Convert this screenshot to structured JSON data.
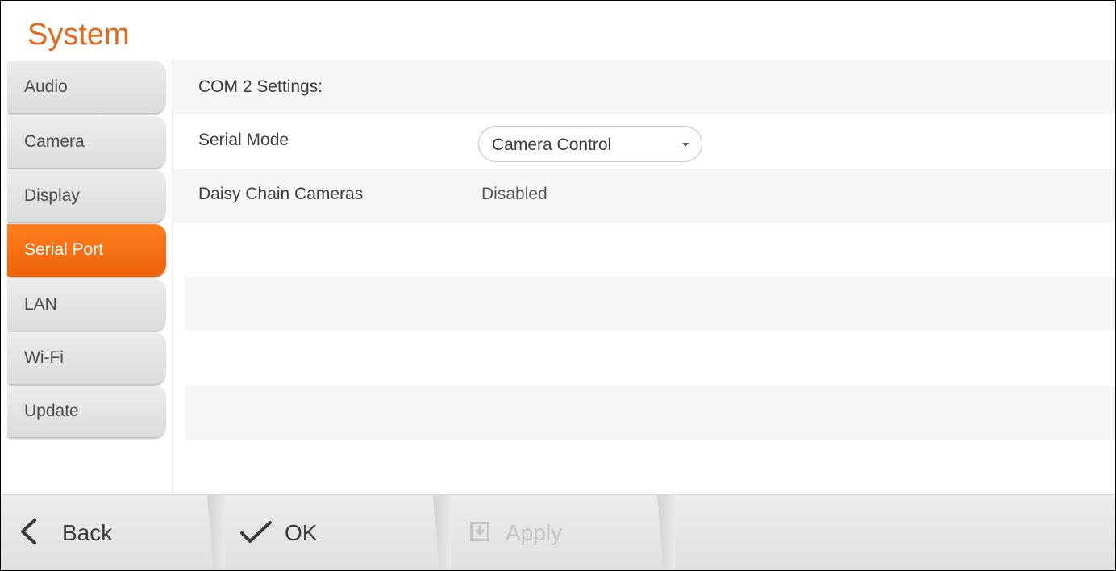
{
  "header": {
    "title": "System"
  },
  "sidebar": {
    "items": [
      {
        "label": "Audio",
        "active": false
      },
      {
        "label": "Camera",
        "active": false
      },
      {
        "label": "Display",
        "active": false
      },
      {
        "label": "Serial Port",
        "active": true
      },
      {
        "label": "LAN",
        "active": false
      },
      {
        "label": "Wi-Fi",
        "active": false
      },
      {
        "label": "Update",
        "active": false
      }
    ]
  },
  "content": {
    "section_title": "COM 2 Settings:",
    "serial_mode": {
      "label": "Serial Mode",
      "value": "Camera Control"
    },
    "daisy_chain": {
      "label": "Daisy Chain Cameras",
      "value": "Disabled"
    }
  },
  "bottom_bar": {
    "back_label": "Back",
    "ok_label": "OK",
    "apply_label": "Apply",
    "apply_enabled": false,
    "icons": {
      "back": "chevron-left-icon",
      "ok": "checkmark-icon",
      "apply": "save-icon"
    }
  },
  "colors": {
    "accent": "#ee6208",
    "title": "#e8671a",
    "band": "#f6f6f4"
  }
}
